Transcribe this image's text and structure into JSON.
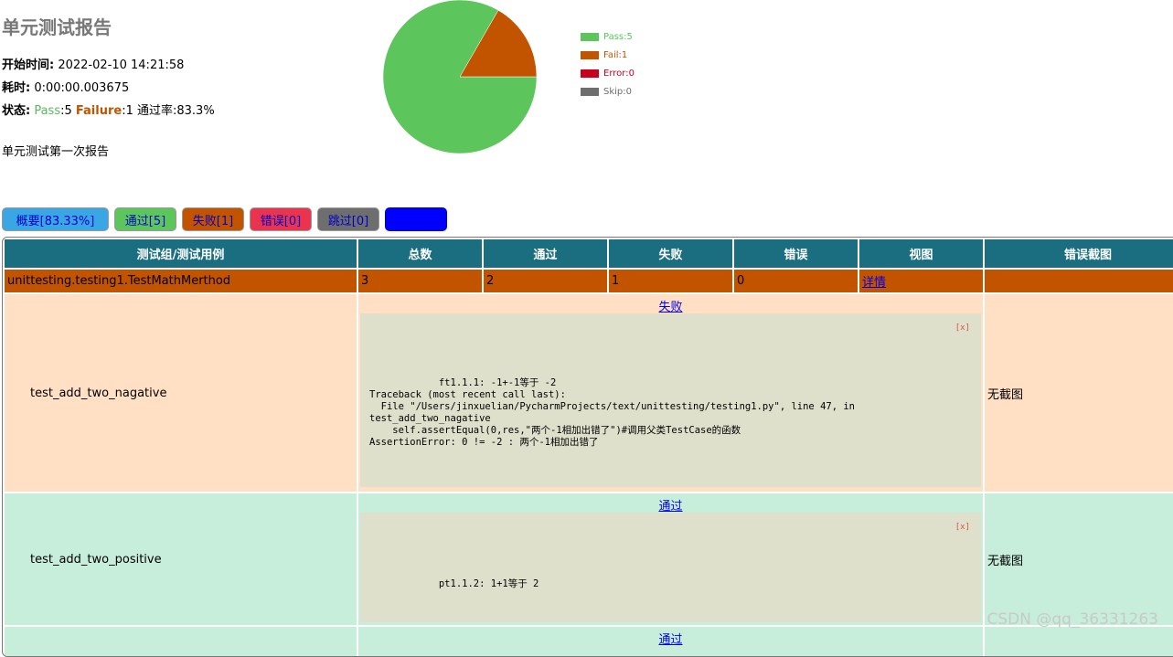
{
  "report": {
    "title": "单元测试报告",
    "start_label": "开始时间:",
    "start_value": " 2022-02-10 14:21:58",
    "duration_label": "耗时:",
    "duration_value": " 0:00:00.003675",
    "status_label": "状态:",
    "status_pass_label": " Pass",
    "status_pass_value": ":5 ",
    "status_fail_label": "Failure",
    "status_fail_value": ":1 ",
    "status_rate": "通过率:83.3%",
    "description": "单元测试第一次报告"
  },
  "chart_data": {
    "type": "pie",
    "categories": [
      "Pass",
      "Fail",
      "Error",
      "Skip"
    ],
    "values": [
      5,
      1,
      0,
      0
    ],
    "colors": [
      "#5cc65c",
      "#c25400",
      "#c8001e",
      "#6e6e6e"
    ],
    "legend": [
      "Pass:5",
      "Fail:1",
      "Error:0",
      "Skip:0"
    ],
    "legend_placement": "right"
  },
  "buttons": {
    "all": "概要[83.33%]",
    "pass": "通过[5]",
    "fail": "失败[1]",
    "error": "错误[0]",
    "skip": "跳过[0]",
    "blank": ""
  },
  "table": {
    "headers": [
      "测试组/测试用例",
      "总数",
      "通过",
      "失败",
      "错误",
      "视图",
      "错误截图"
    ],
    "class_row": {
      "name": "unittesting.testing1.TestMathMerthod",
      "total": "3",
      "pass": "2",
      "fail": "1",
      "error": "0",
      "view": "详情",
      "screenshot": ""
    },
    "cases": [
      {
        "name": "test_add_two_nagative",
        "status": "失败",
        "close": "[x]",
        "trace": "ft1.1.1: -1+-1等于 -2\nTraceback (most recent call last):\n  File \"/Users/jinxuelian/PycharmProjects/text/unittesting/testing1.py\", line 47, in\ntest_add_two_nagative\n    self.assertEqual(0,res,\"两个-1相加出错了\")#调用父类TestCase的函数\nAssertionError: 0 != -2 : 两个-1相加出错了",
        "screenshot": "无截图"
      },
      {
        "name": "test_add_two_positive",
        "status": "通过",
        "close": "[x]",
        "trace": "pt1.1.2: 1+1等于 2",
        "screenshot": "无截图"
      },
      {
        "name": "",
        "status": "通过"
      }
    ]
  },
  "watermark": "CSDN @qq_36331263"
}
